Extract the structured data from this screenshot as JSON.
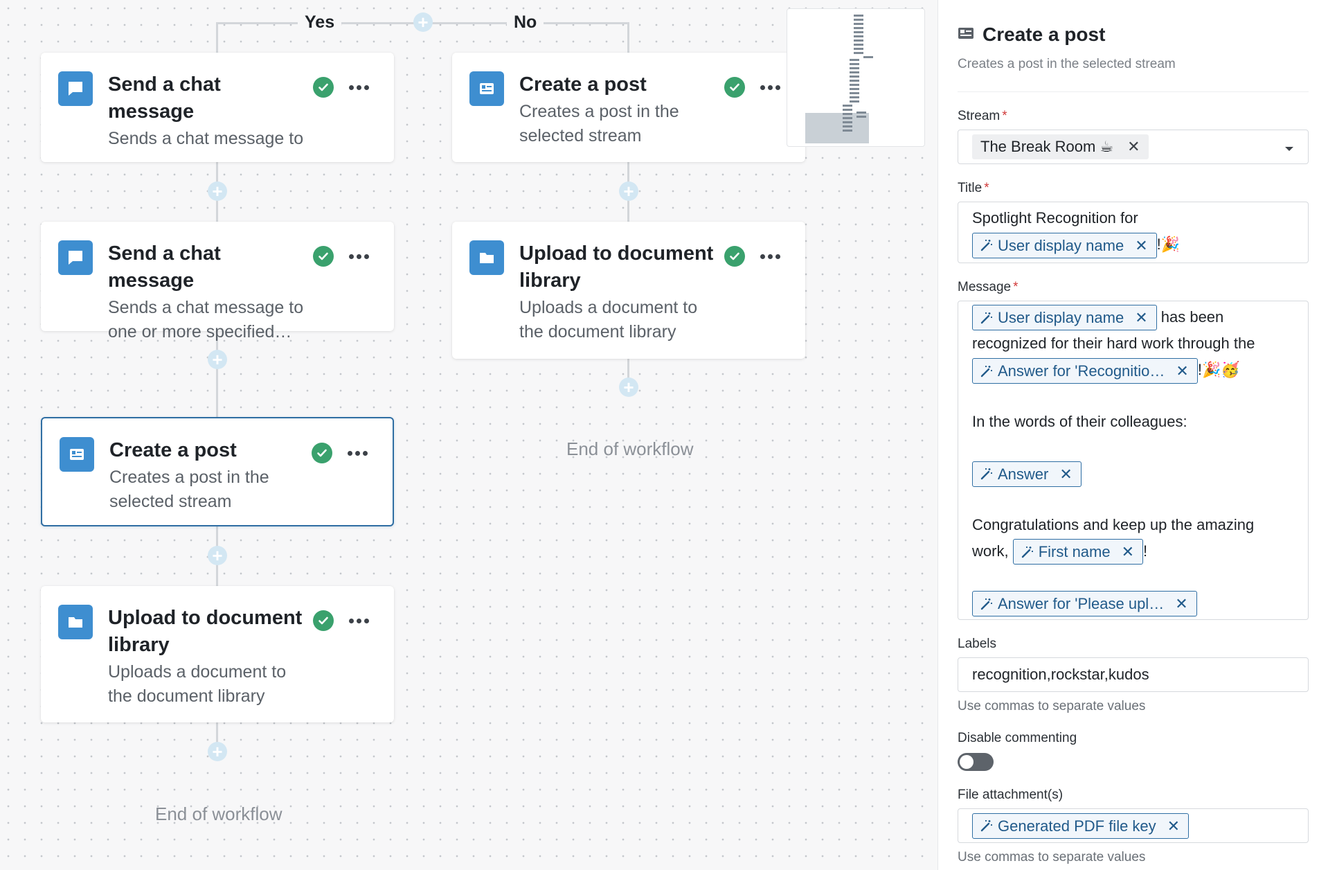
{
  "canvas": {
    "branch_yes": "Yes",
    "branch_no": "No",
    "left_column": [
      {
        "title": "Send a chat message",
        "desc": "Sends a chat message to one or more specified…",
        "icon": "chat-icon"
      },
      {
        "title": "Send a chat message",
        "desc": "Sends a chat message to one or more specified…",
        "icon": "chat-icon"
      },
      {
        "title": "Create a post",
        "desc": "Creates a post in the selected stream",
        "icon": "post-icon",
        "selected": true
      },
      {
        "title": "Upload to document library",
        "desc": "Uploads a document to the document library",
        "icon": "folder-icon"
      }
    ],
    "right_column": [
      {
        "title": "Create a post",
        "desc": "Creates a post in the selected stream",
        "icon": "post-icon"
      },
      {
        "title": "Upload to document library",
        "desc": "Uploads a document to the document library",
        "icon": "folder-icon"
      }
    ],
    "end_left": "End of workflow",
    "end_right": "End of workflow"
  },
  "panel": {
    "title": "Create a post",
    "subtitle": "Creates a post in the selected stream",
    "stream": {
      "label": "Stream",
      "required_mark": "*",
      "value": "The Break Room ☕"
    },
    "title_field": {
      "label": "Title",
      "required_mark": "*",
      "text": "Spotlight Recognition for",
      "token": "User display name",
      "suffix": "!🎉"
    },
    "message": {
      "label": "Message",
      "required_mark": "*",
      "token1": "User display name",
      "text1": "has been",
      "text2": "recognized for their hard work through the",
      "token2": "Answer for 'Recognitio…",
      "suffix2": "!🎉🥳",
      "text3": "In the words of their colleagues:",
      "token3": "Answer",
      "text4": "Congratulations and keep up the amazing",
      "text5": "work,",
      "token4": "First name",
      "suffix4": "!",
      "token5": "Answer for 'Please upl…"
    },
    "labels": {
      "label": "Labels",
      "value": "recognition,rockstar,kudos",
      "hint": "Use commas to separate values"
    },
    "disable_commenting": {
      "label": "Disable commenting",
      "on": false
    },
    "attachments": {
      "label": "File attachment(s)",
      "token": "Generated PDF file key",
      "hint": "Use commas to separate values"
    }
  },
  "colors": {
    "accent": "#3e8ed0",
    "success": "#3aa16d",
    "token_border": "#2f6ea3"
  }
}
